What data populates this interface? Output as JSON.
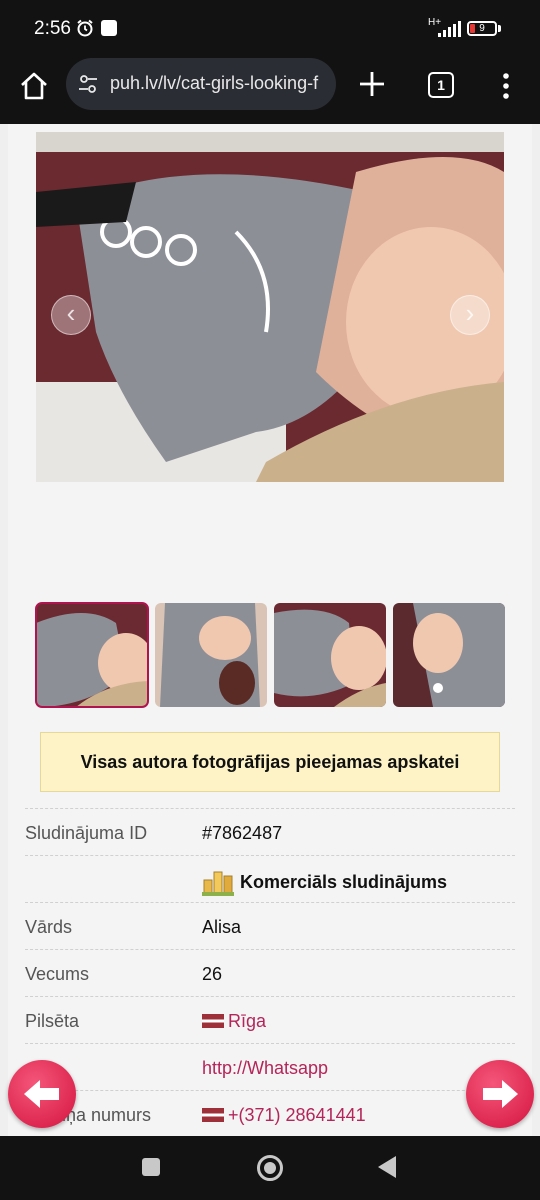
{
  "status_bar": {
    "time": "2:56",
    "network_type": "H+",
    "battery_level": "9"
  },
  "browser": {
    "url": "puh.lv/lv/cat-girls-looking-f",
    "tab_count": "1"
  },
  "gallery": {
    "prev_symbol": "‹",
    "next_symbol": "›",
    "thumbnail_count": 4,
    "active_thumbnail": 1
  },
  "notice": {
    "text": "Visas autora fotogrāfijas pieejamas apskatei"
  },
  "details": {
    "ad_id_label": "Sludinājuma ID",
    "ad_id_value": "#7862487",
    "commercial_label": "Komerciāls sludinājums",
    "name_label": "Vārds",
    "name_value": "Alisa",
    "age_label": "Vecums",
    "age_value": "26",
    "city_label": "Pilsēta",
    "city_value": "Rīga",
    "whatsapp_value": "http://Whatsapp",
    "phone_label": "Tālruņa numurs",
    "phone_value": "+(371) 28641441"
  },
  "colors": {
    "link": "#b42559",
    "notice_bg": "#fdf3c7",
    "nav_arrow": "#e02a52"
  }
}
